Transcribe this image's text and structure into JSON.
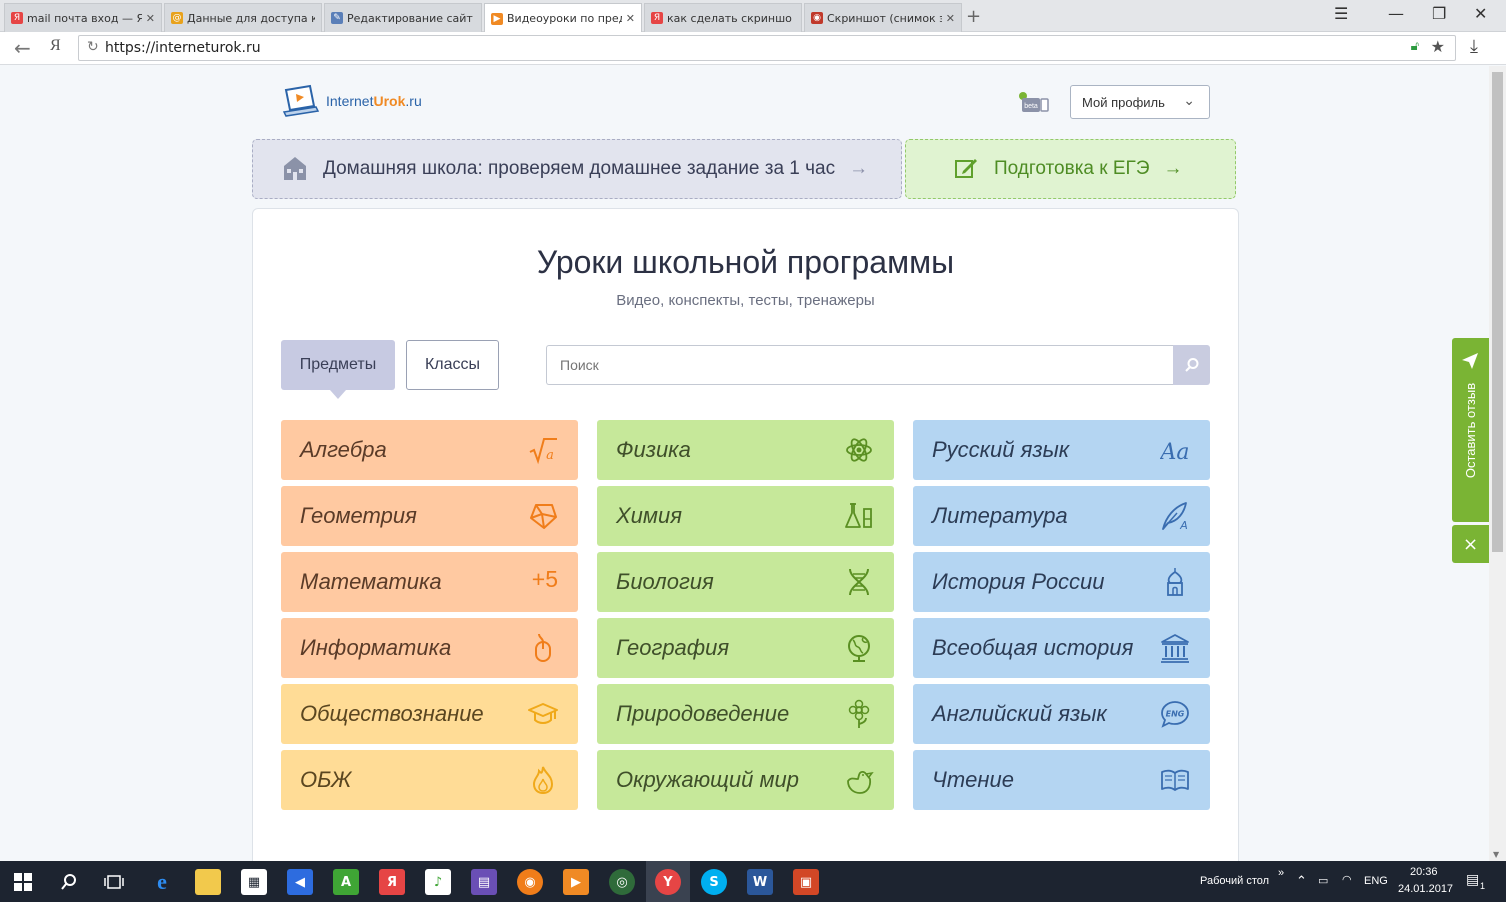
{
  "browser": {
    "tabs": [
      {
        "title": "mail почта вход — Ян",
        "favicon_color": "#e64545",
        "favicon_glyph": "Я"
      },
      {
        "title": "Данные для доступа к",
        "favicon_color": "#e8a21c",
        "favicon_glyph": "@"
      },
      {
        "title": "Редактирование сайт",
        "favicon_color": "#5a7fb8",
        "favicon_glyph": "✎"
      },
      {
        "title": "Видеоуроки по предм",
        "favicon_color": "#f08a24",
        "favicon_glyph": "▶"
      },
      {
        "title": "как сделать скриншо",
        "favicon_color": "#e64545",
        "favicon_glyph": "Я"
      },
      {
        "title": "Скриншот (снимок э",
        "favicon_color": "#c0392b",
        "favicon_glyph": "◉"
      }
    ],
    "active_tab": 3,
    "url": "https://interneturok.ru",
    "ya_button": "Я"
  },
  "header": {
    "logo_text_1": "Internet",
    "logo_text_2": "Urok",
    "logo_text_3": ".ru",
    "profile_label": "Мой профиль"
  },
  "promo": {
    "home_school": "Домашняя школа: проверяем домашнее задание за 1 час",
    "ege": "Подготовка к ЕГЭ",
    "arrow": "→"
  },
  "main": {
    "title": "Уроки школьной программы",
    "subtitle": "Видео, конспекты, тесты, тренажеры",
    "tab_subjects": "Предметы",
    "tab_classes": "Классы",
    "search_placeholder": "Поиск"
  },
  "subjects": {
    "col1": [
      {
        "label": "Алгебра",
        "icon": "sqrt-icon",
        "color": "orange"
      },
      {
        "label": "Геометрия",
        "icon": "polyhedron-icon",
        "color": "orange"
      },
      {
        "label": "Математика",
        "icon": "plus-five-icon",
        "color": "orange"
      },
      {
        "label": "Информатика",
        "icon": "mouse-icon",
        "color": "orange"
      },
      {
        "label": "Обществознание",
        "icon": "graduation-cap-icon",
        "color": "yellow"
      },
      {
        "label": "ОБЖ",
        "icon": "fire-icon",
        "color": "yellow"
      }
    ],
    "col2": [
      {
        "label": "Физика",
        "icon": "atom-icon"
      },
      {
        "label": "Химия",
        "icon": "flask-icon"
      },
      {
        "label": "Биология",
        "icon": "dna-icon"
      },
      {
        "label": "География",
        "icon": "globe-icon"
      },
      {
        "label": "Природоведение",
        "icon": "flower-icon"
      },
      {
        "label": "Окружающий мир",
        "icon": "bird-icon"
      }
    ],
    "col3": [
      {
        "label": "Русский язык",
        "icon": "letters-icon"
      },
      {
        "label": "Литература",
        "icon": "quill-icon"
      },
      {
        "label": "История России",
        "icon": "church-icon"
      },
      {
        "label": "Всеобщая история",
        "icon": "museum-icon"
      },
      {
        "label": "Английский язык",
        "icon": "eng-bubble-icon"
      },
      {
        "label": "Чтение",
        "icon": "book-icon"
      }
    ],
    "plus_five": "+5",
    "eng_badge": "ENG"
  },
  "feedback": {
    "label": "Оставить отзыв",
    "close": "×"
  },
  "taskbar": {
    "desktop_label": "Рабочий стол",
    "lang": "ENG",
    "time": "20:36",
    "date": "24.01.2017",
    "notify_count": "1"
  },
  "colors": {
    "orange_tile": "#ffc9a1",
    "yellow_tile": "#ffdc96",
    "green_tile": "#c6e89a",
    "blue_tile": "#b4d5f2",
    "feedback_green": "#7ab434",
    "brand_blue": "#2a63a8"
  }
}
